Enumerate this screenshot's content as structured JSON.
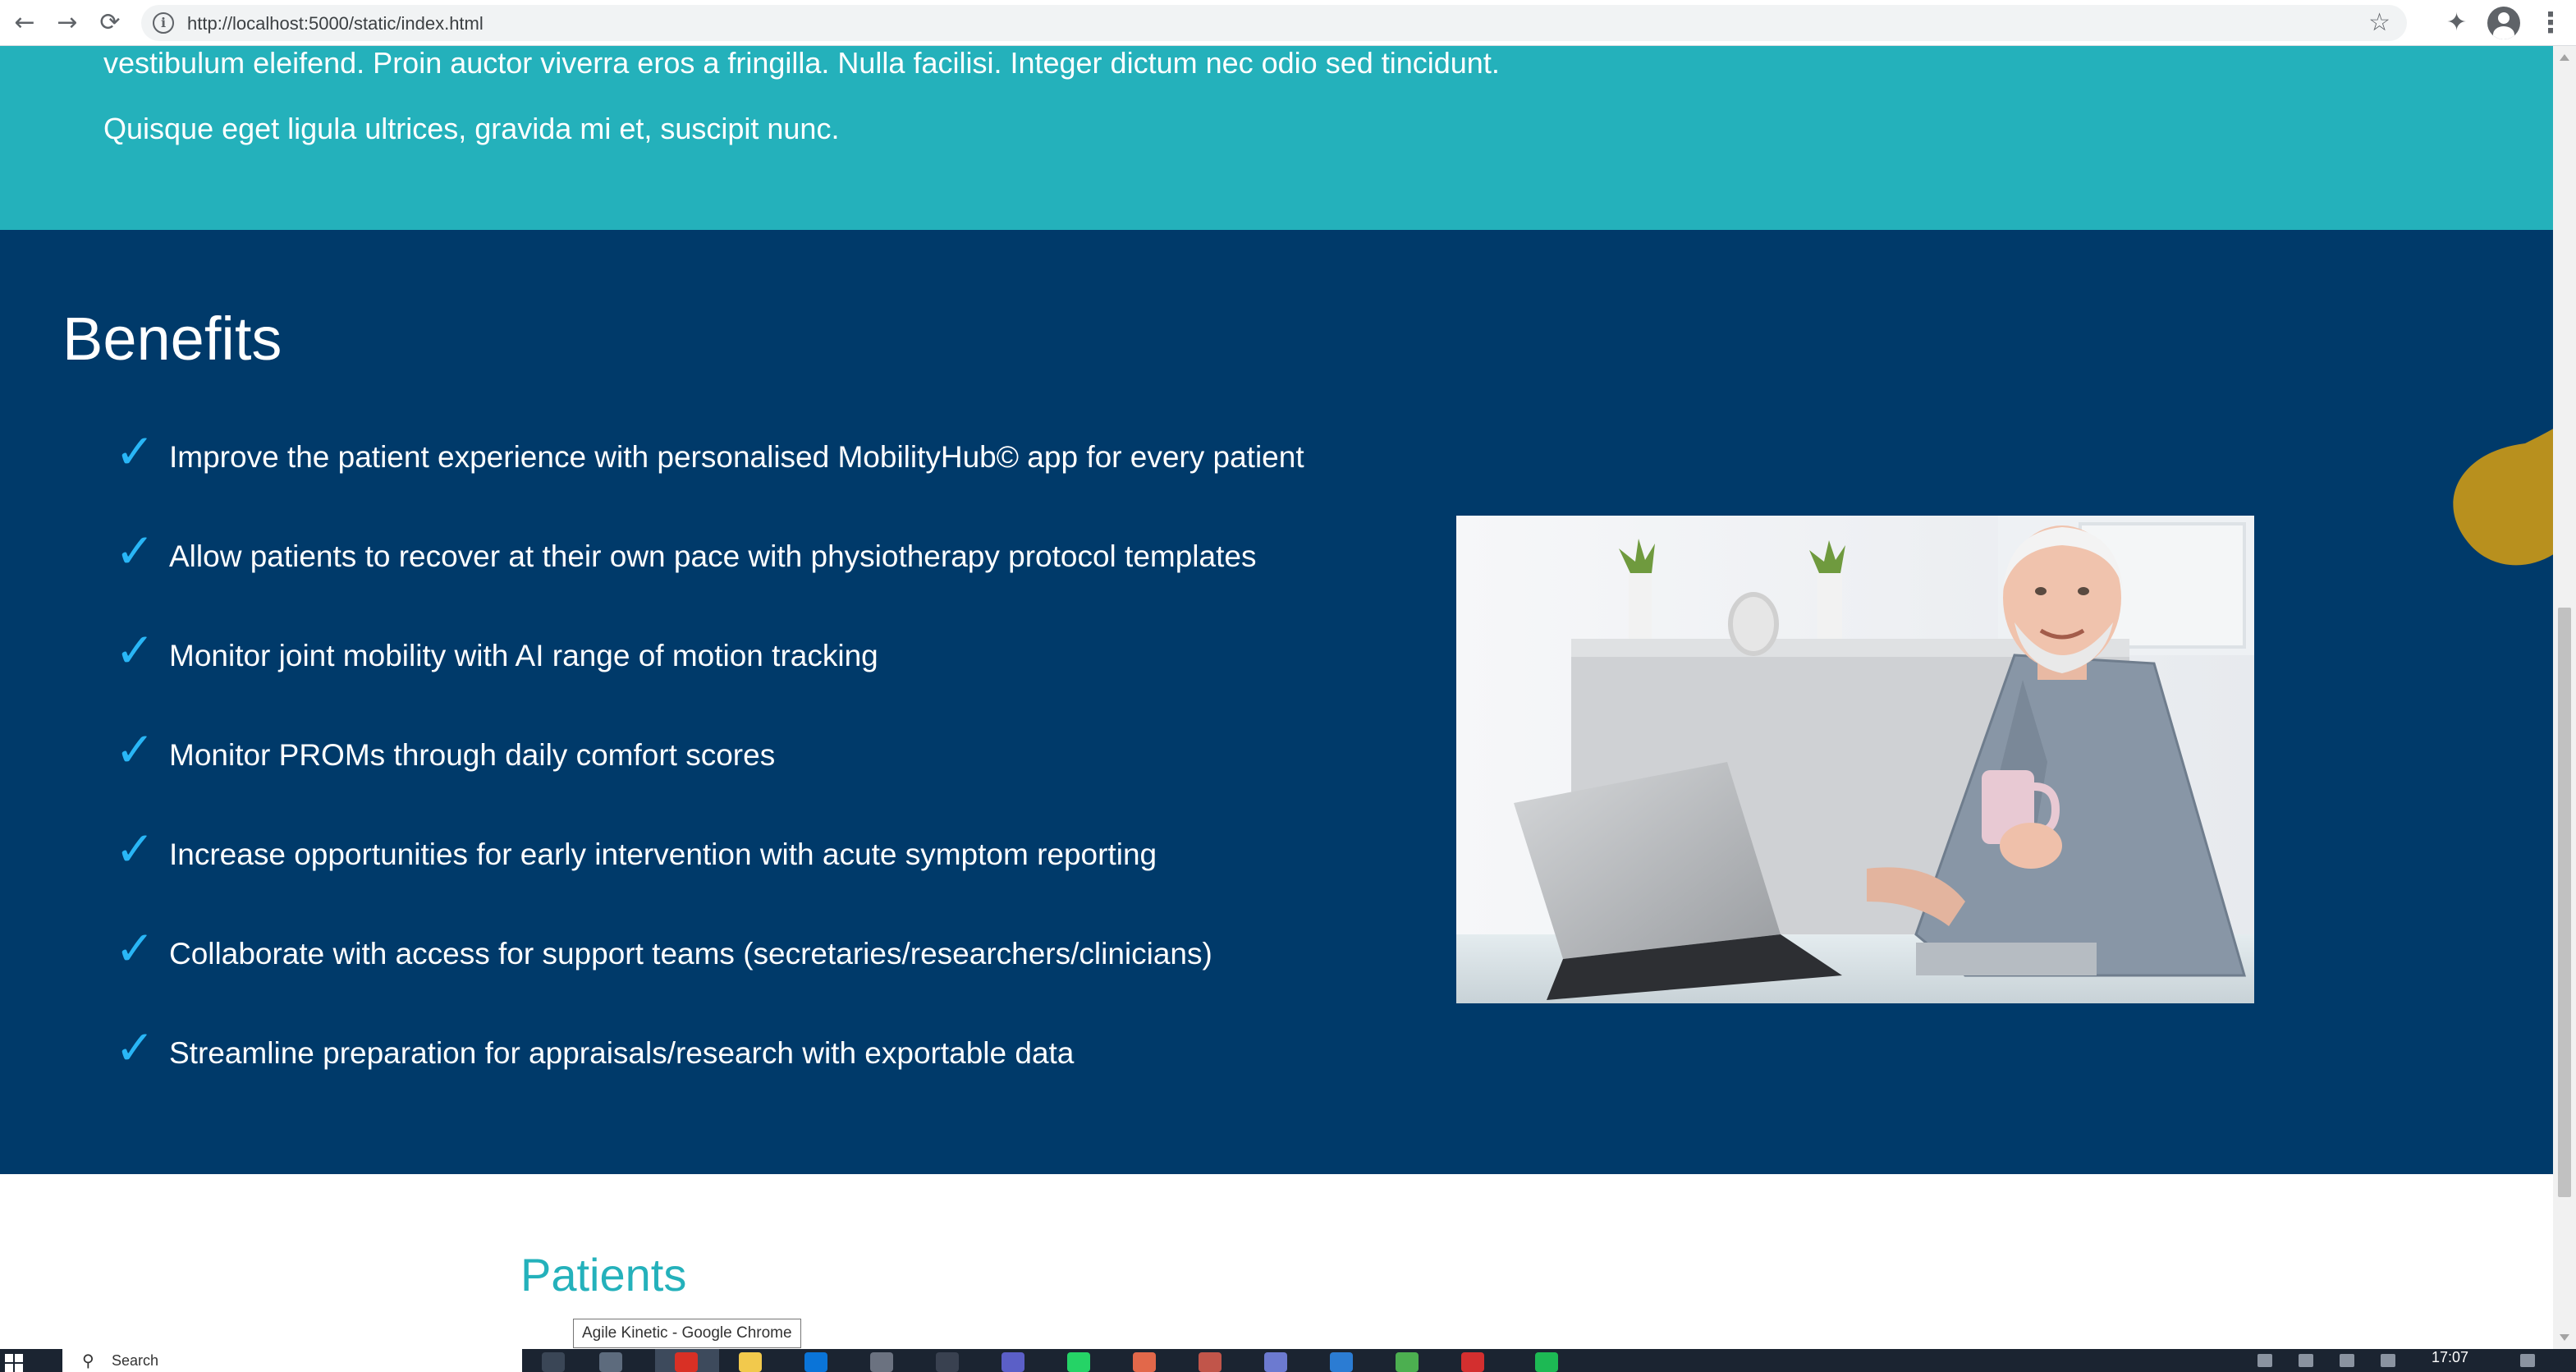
{
  "browser": {
    "url": "http://localhost:5000/static/index.html",
    "back_icon": "arrow-left-icon",
    "forward_icon": "arrow-right-icon",
    "reload_icon": "reload-icon"
  },
  "intro": {
    "paragraph_1": "vestibulum eleifend. Proin auctor viverra eros a fringilla. Nulla facilisi. Integer dictum nec odio sed tincidunt.",
    "paragraph_2": "Quisque eget ligula ultrices, gravida mi et, suscipit nunc."
  },
  "benefits": {
    "title": "Benefits",
    "check_glyph": "✓",
    "items": [
      "Improve the patient experience with personalised MobilityHub© app for every patient",
      "Allow patients to recover at their own pace with physiotherapy protocol templates",
      "Monitor joint mobility with AI range of motion tracking",
      "Monitor PROMs through daily comfort scores",
      "Increase opportunities for early intervention with acute symptom reporting",
      "Collaborate with access for support teams (secretaries/researchers/clinicians)",
      "Streamline preparation for appraisals/research with exportable data"
    ]
  },
  "patients": {
    "title": "Patients"
  },
  "tooltip": "Agile Kinetic - Google Chrome",
  "taskbar": {
    "search_label": "Search",
    "clock": "17:07"
  },
  "colors": {
    "teal": "#24b1bb",
    "navy": "#003a6a",
    "check": "#29b6f6",
    "gold": "#b8901e"
  }
}
